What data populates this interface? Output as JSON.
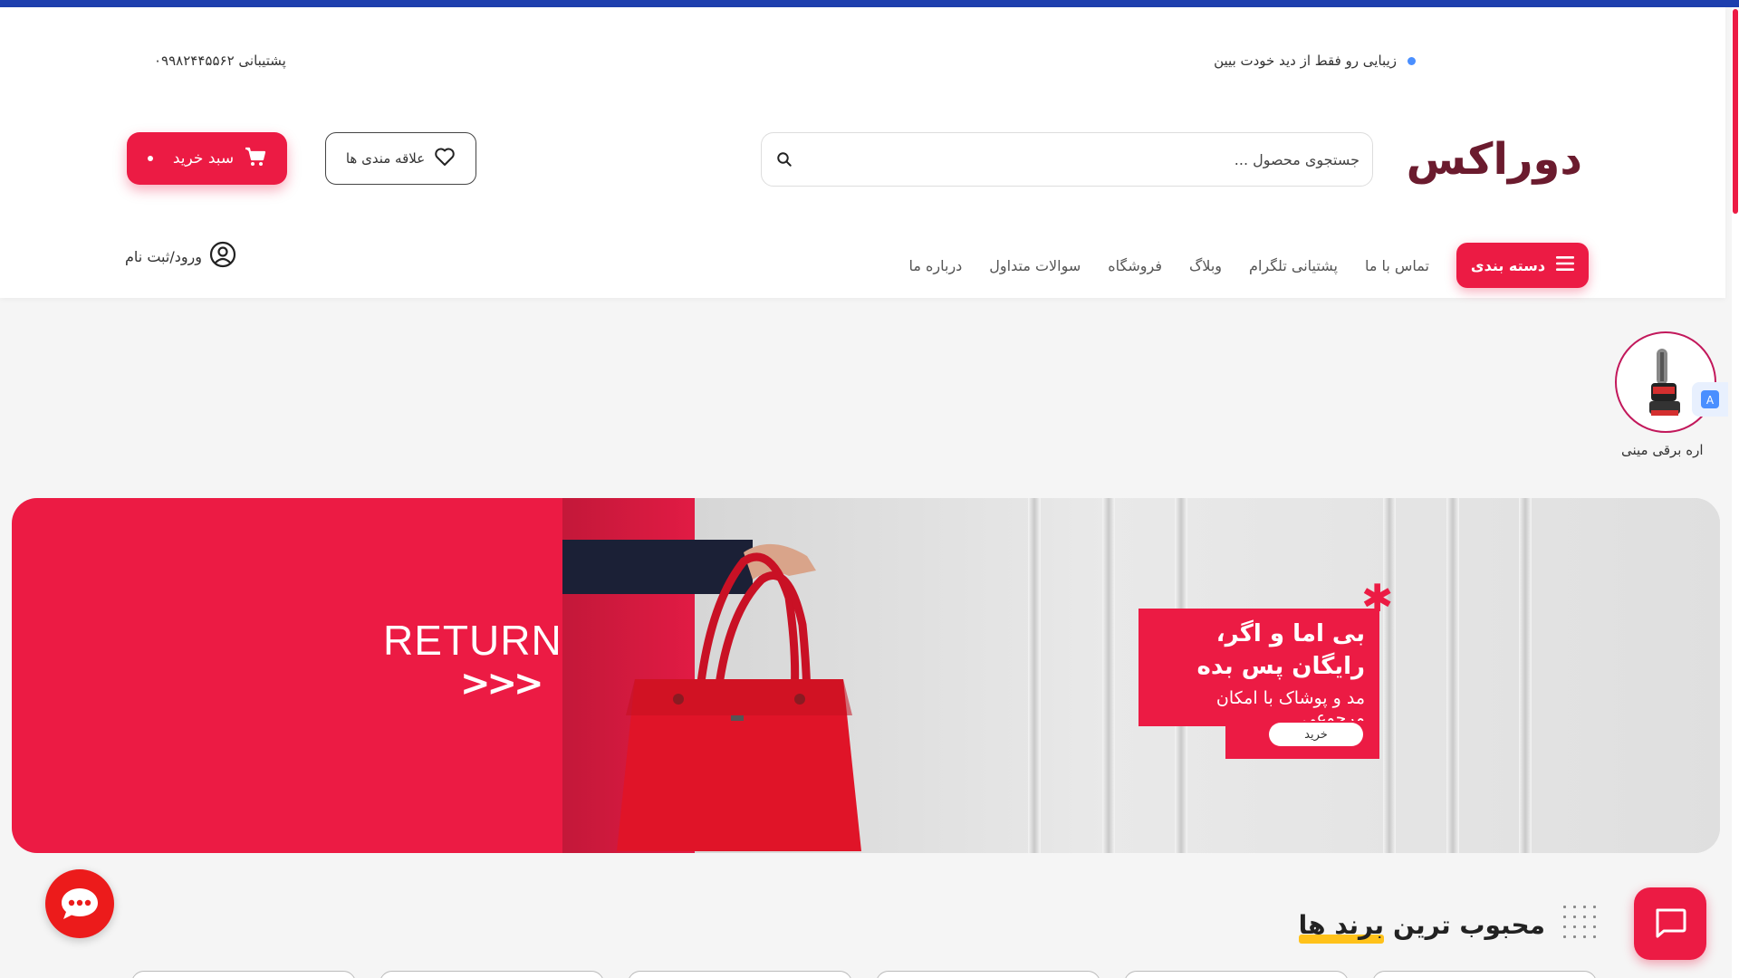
{
  "announcement": "زیبایی رو فقط از دید خودت بیین",
  "support": "پشتیبانی ۰۹۹۸۲۴۴۵۵۶۲",
  "logo": "دوراکس",
  "search": {
    "placeholder": "جستجوی محصول ..."
  },
  "wishlist_label": "علاقه مندی ها",
  "cart_label": "سبد خرید",
  "category_button": "دسته بندی",
  "nav": [
    "تماس با ما",
    "پشتیانی تلگرام",
    "وبلاگ",
    "فروشگاه",
    "سوالات متداول",
    "درباره ما"
  ],
  "login_label": "ورود/ثبت نام",
  "story": {
    "label": "اره برقی مینی"
  },
  "banner": {
    "left_text": "RETURN",
    "left_arrows": ">>>",
    "promo_line1": "بی اما و اگر،",
    "promo_line2": "رایگان پس بده",
    "promo_sub": "مد و پوشاک با امکان مرجوعی",
    "promo_button": "خرید"
  },
  "brands": {
    "title_part1": "محبوب ترین",
    "title_part2": "برند ها"
  },
  "colors": {
    "accent": "#ec1b44",
    "topbar": "#1e3fae",
    "logo": "#6b1b2e",
    "highlight": "#ffc21a"
  }
}
